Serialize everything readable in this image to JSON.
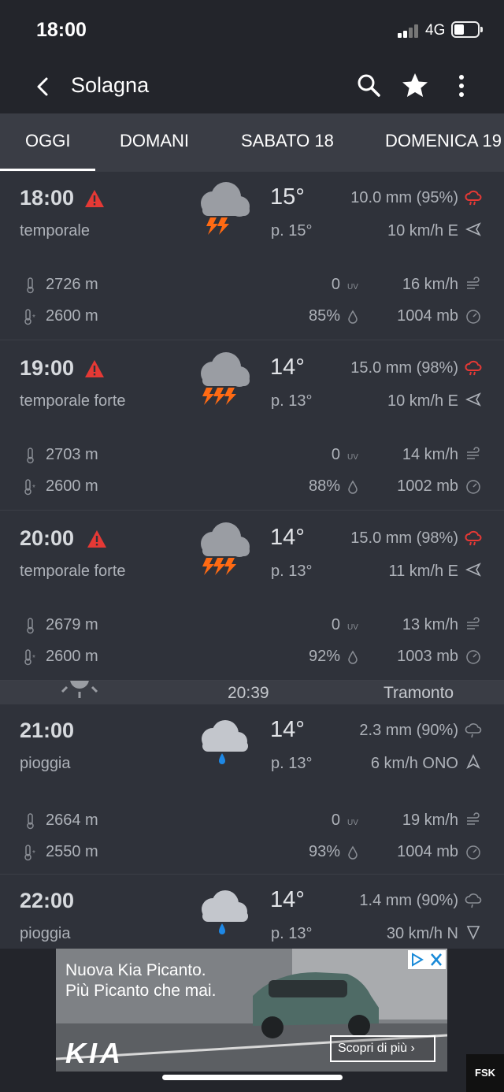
{
  "status_bar": {
    "time": "18:00",
    "network": "4G"
  },
  "app_bar": {
    "title": "Solagna"
  },
  "tabs": [
    {
      "label": "OGGI",
      "active": true
    },
    {
      "label": "DOMANI"
    },
    {
      "label": "SABATO 18"
    },
    {
      "label": "DOMENICA 19"
    }
  ],
  "hours": [
    {
      "time": "18:00",
      "warning": true,
      "desc": "temporale",
      "icon": "thunderstorm-icon",
      "temp": "15°",
      "feels": "p. 15°",
      "rain": "10.0 mm (95%)",
      "wind": "10 km/h E",
      "freezing_alt": "2726 m",
      "snow_alt": "2600 m",
      "uv": "0",
      "humidity": "85%",
      "gust": "16 km/h",
      "pressure": "1004 mb"
    },
    {
      "time": "19:00",
      "warning": true,
      "desc": "temporale forte",
      "icon": "heavy-thunderstorm-icon",
      "temp": "14°",
      "feels": "p. 13°",
      "rain": "15.0 mm (98%)",
      "wind": "10 km/h E",
      "freezing_alt": "2703 m",
      "snow_alt": "2600 m",
      "uv": "0",
      "humidity": "88%",
      "gust": "14 km/h",
      "pressure": "1002 mb"
    },
    {
      "time": "20:00",
      "warning": true,
      "desc": "temporale forte",
      "icon": "heavy-thunderstorm-icon",
      "temp": "14°",
      "feels": "p. 13°",
      "rain": "15.0 mm (98%)",
      "wind": "11 km/h E",
      "freezing_alt": "2679 m",
      "snow_alt": "2600 m",
      "uv": "0",
      "humidity": "92%",
      "gust": "13 km/h",
      "pressure": "1003 mb"
    },
    {
      "time": "21:00",
      "warning": false,
      "desc": "pioggia",
      "icon": "rain-cloud-icon",
      "temp": "14°",
      "feels": "p. 13°",
      "rain": "2.3 mm (90%)",
      "wind": "6 km/h ONO",
      "freezing_alt": "2664 m",
      "snow_alt": "2550 m",
      "uv": "0",
      "humidity": "93%",
      "gust": "19 km/h",
      "pressure": "1004 mb"
    },
    {
      "time": "22:00",
      "warning": false,
      "desc": "pioggia",
      "icon": "rain-cloud-icon",
      "temp": "14°",
      "feels": "p. 13°",
      "rain": "1.4 mm (90%)",
      "wind": "30 km/h N"
    }
  ],
  "sunset": {
    "time": "20:39",
    "label": "Tramonto"
  },
  "ad": {
    "line1": "Nuova Kia Picanto.",
    "line2": "Più Picanto che mai.",
    "logo": "KIA",
    "cta": "Scopri di più",
    "badge": "FSK"
  },
  "colors": {
    "warning": "#e53935",
    "lightning": "#ff6a13",
    "rain_drop": "#1e88e5",
    "background": "#2f323a",
    "bar": "#23252b"
  }
}
